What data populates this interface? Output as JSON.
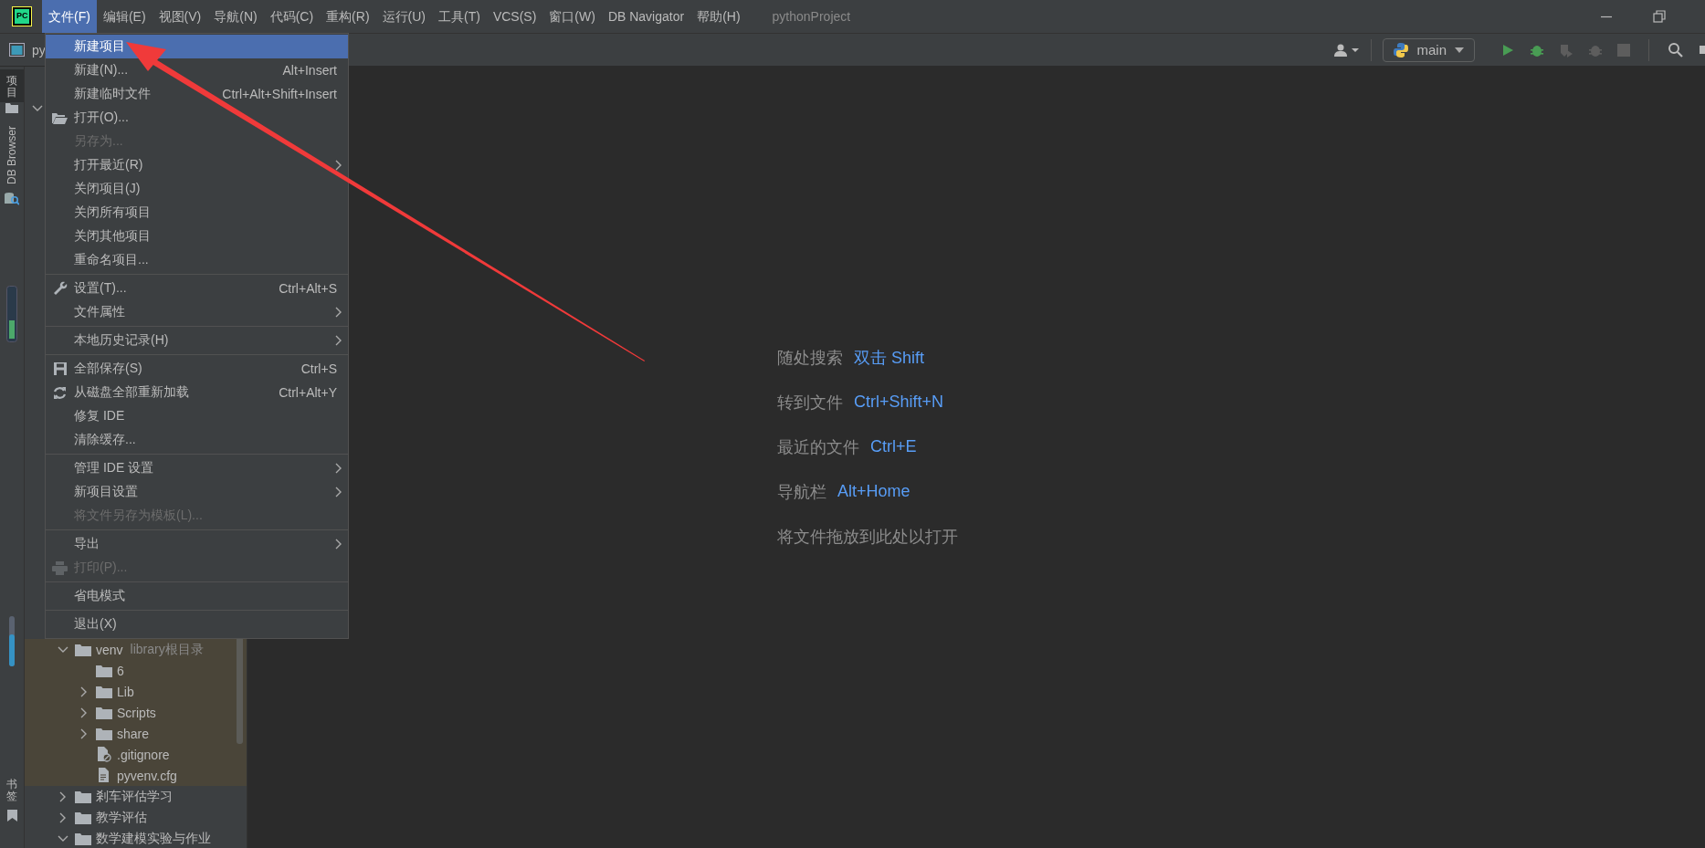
{
  "menu_bar": {
    "logo": "PC",
    "items": [
      {
        "label": "文件(F)",
        "selected": true
      },
      {
        "label": "编辑(E)",
        "selected": false
      },
      {
        "label": "视图(V)",
        "selected": false
      },
      {
        "label": "导航(N)",
        "selected": false
      },
      {
        "label": "代码(C)",
        "selected": false
      },
      {
        "label": "重构(R)",
        "selected": false
      },
      {
        "label": "运行(U)",
        "selected": false
      },
      {
        "label": "工具(T)",
        "selected": false
      },
      {
        "label": "VCS(S)",
        "selected": false
      },
      {
        "label": "窗口(W)",
        "selected": false
      },
      {
        "label": "DB Navigator",
        "selected": false
      },
      {
        "label": "帮助(H)",
        "selected": false
      }
    ]
  },
  "window": {
    "title": "pythonProject"
  },
  "toolbar": {
    "breadcrumb": "py",
    "run_config": "main"
  },
  "tool_strip": {
    "tabs": [
      {
        "label": "项目",
        "kind": "cjk",
        "selected": true
      },
      {
        "label": "DB Browser",
        "kind": "latin",
        "selected": false
      }
    ],
    "bottom_tab": "书签"
  },
  "file_menu": {
    "groups": [
      [
        {
          "label": "新建项目",
          "selected": true,
          "disabled": false,
          "submenu": false
        },
        {
          "label": "新建(N)...",
          "shortcut": "Alt+Insert",
          "selected": false,
          "disabled": false,
          "submenu": false
        },
        {
          "label": "新建临时文件",
          "shortcut": "Ctrl+Alt+Shift+Insert",
          "selected": false,
          "disabled": false,
          "submenu": false
        },
        {
          "label": "打开(O)...",
          "selected": false,
          "disabled": false,
          "submenu": false
        },
        {
          "label": "另存为...",
          "selected": false,
          "disabled": true,
          "submenu": false
        },
        {
          "label": "打开最近(R)",
          "selected": false,
          "disabled": false,
          "submenu": true
        },
        {
          "label": "关闭项目(J)",
          "selected": false,
          "disabled": false,
          "submenu": false
        },
        {
          "label": "关闭所有项目",
          "selected": false,
          "disabled": false,
          "submenu": false
        },
        {
          "label": "关闭其他项目",
          "selected": false,
          "disabled": false,
          "submenu": false
        },
        {
          "label": "重命名项目...",
          "selected": false,
          "disabled": false,
          "submenu": false
        }
      ],
      [
        {
          "label": "设置(T)...",
          "shortcut": "Ctrl+Alt+S",
          "selected": false,
          "disabled": false,
          "submenu": false
        },
        {
          "label": "文件属性",
          "selected": false,
          "disabled": false,
          "submenu": true
        }
      ],
      [
        {
          "label": "本地历史记录(H)",
          "selected": false,
          "disabled": false,
          "submenu": true
        }
      ],
      [
        {
          "label": "全部保存(S)",
          "shortcut": "Ctrl+S",
          "selected": false,
          "disabled": false,
          "submenu": false
        },
        {
          "label": "从磁盘全部重新加载",
          "shortcut": "Ctrl+Alt+Y",
          "selected": false,
          "disabled": false,
          "submenu": false
        },
        {
          "label": "修复 IDE",
          "selected": false,
          "disabled": false,
          "submenu": false
        },
        {
          "label": "清除缓存...",
          "selected": false,
          "disabled": false,
          "submenu": false
        }
      ],
      [
        {
          "label": "管理 IDE 设置",
          "selected": false,
          "disabled": false,
          "submenu": true
        },
        {
          "label": "新项目设置",
          "selected": false,
          "disabled": false,
          "submenu": true
        },
        {
          "label": "将文件另存为模板(L)...",
          "selected": false,
          "disabled": true,
          "submenu": false
        }
      ],
      [
        {
          "label": "导出",
          "selected": false,
          "disabled": false,
          "submenu": true
        },
        {
          "label": "打印(P)...",
          "selected": false,
          "disabled": true,
          "submenu": false
        }
      ],
      [
        {
          "label": "省电模式",
          "selected": false,
          "disabled": false,
          "submenu": false
        }
      ],
      [
        {
          "label": "退出(X)",
          "selected": false,
          "disabled": false,
          "submenu": false
        }
      ]
    ]
  },
  "project_tree": [
    {
      "label": "venv",
      "note": "library根目录",
      "kind": "folder",
      "expanded": true,
      "library_root": true,
      "children": [
        {
          "label": "6",
          "kind": "empty-folder"
        },
        {
          "label": "Lib",
          "kind": "folder",
          "expanded": false
        },
        {
          "label": "Scripts",
          "kind": "folder",
          "expanded": false
        },
        {
          "label": "share",
          "kind": "folder",
          "expanded": false
        },
        {
          "label": ".gitignore",
          "kind": "ignored-file"
        },
        {
          "label": "pyvenv.cfg",
          "kind": "text-file"
        }
      ]
    },
    {
      "label": "剎车评估学习",
      "kind": "folder",
      "expanded": false,
      "library_root": false
    },
    {
      "label": "教学评估",
      "kind": "folder",
      "expanded": false,
      "library_root": false
    },
    {
      "label": "数学建模实验与作业",
      "kind": "folder",
      "expanded": true,
      "library_root": false
    }
  ],
  "welcome": {
    "hints": [
      {
        "label": "随处搜索",
        "shortcut": "双击 Shift"
      },
      {
        "label": "转到文件",
        "shortcut": "Ctrl+Shift+N"
      },
      {
        "label": "最近的文件",
        "shortcut": "Ctrl+E"
      },
      {
        "label": "导航栏",
        "shortcut": "Alt+Home"
      },
      {
        "label": "将文件拖放到此处以打开"
      }
    ]
  }
}
